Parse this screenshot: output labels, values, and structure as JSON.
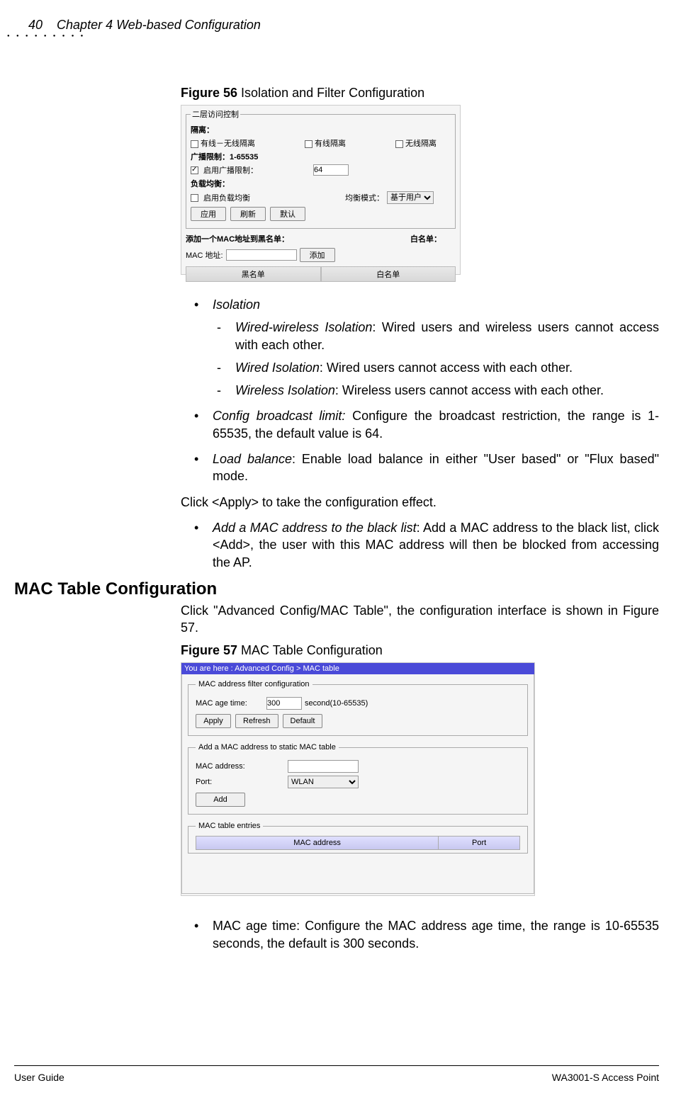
{
  "header": {
    "page_number": "40",
    "chapter": "Chapter 4 Web-based Configuration"
  },
  "figure56": {
    "caption_num": "Figure 56",
    "caption_text": " Isolation and Filter Configuration",
    "panel_title": "二层访问控制",
    "isolation_label": "隔离：",
    "cb_wired_wireless": "有线－无线隔离",
    "cb_wired": "有线隔离",
    "cb_wireless": "无线隔离",
    "broadcast_label": "广播限制：1-65535",
    "enable_broadcast": "启用广播限制：",
    "broadcast_value": "64",
    "loadbalance_label": "负载均衡：",
    "enable_loadbalance": "启用负载均衡",
    "balance_mode_label": "均衡模式：",
    "balance_mode_value": "基于用户",
    "btn_apply": "应用",
    "btn_refresh": "刷新",
    "btn_default": "默认",
    "add_mac_label": "添加一个MAC地址到黑名单：",
    "whitelist_label": "白名单：",
    "mac_addr_label": "MAC 地址:",
    "btn_add": "添加",
    "blacklist_header": "黑名单",
    "whitelist_header": "白名单"
  },
  "bullets1": {
    "isolation": "Isolation",
    "dash1_term": "Wired-wireless Isolation",
    "dash1_text": ": Wired users and wireless users cannot access with each other.",
    "dash2_term": "Wired Isolation",
    "dash2_text": ": Wired users cannot access with each other.",
    "dash3_term": "Wireless Isolation",
    "dash3_text": ": Wireless users cannot access with each other.",
    "b2_term": "Config broadcast limit:",
    "b2_text": " Configure the broadcast restriction, the range is 1-65535, the default value is 64.",
    "b3_term": "Load balance",
    "b3_text": ": Enable load balance in either \"User based\" or \"Flux based\" mode.",
    "apply_text": "Click <Apply> to take the configuration effect.",
    "b4_term": "Add a MAC address to the black list",
    "b4_text": ": Add a MAC address to the black list, click <Add>, the user with this MAC address will then be blocked from accessing the AP."
  },
  "section_heading": "MAC Table Configuration",
  "paragraph2": "Click \"Advanced Config/MAC Table\", the configuration interface is shown in Figure 57.",
  "figure57": {
    "caption_num": "Figure 57",
    "caption_text": " MAC Table Configuration",
    "breadcrumb": "You are here : Advanced Config > MAC table",
    "fieldset1_legend": "MAC address filter configuration",
    "mac_age_label": "MAC age time:",
    "mac_age_value": "300",
    "mac_age_unit": "second(10-65535)",
    "btn_apply": "Apply",
    "btn_refresh": "Refresh",
    "btn_default": "Default",
    "fieldset2_legend": "Add a MAC address to static MAC table",
    "mac_address_label": "MAC address:",
    "port_label": "Port:",
    "port_value": "WLAN",
    "btn_add": "Add",
    "fieldset3_legend": "MAC table entries",
    "th_mac": "MAC address",
    "th_port": "Port"
  },
  "bullets2": {
    "b1": "MAC age time: Configure the MAC address age time, the range is 10-65535 seconds, the default is 300 seconds."
  },
  "footer": {
    "left": "User Guide",
    "right": "WA3001-S Access Point"
  }
}
